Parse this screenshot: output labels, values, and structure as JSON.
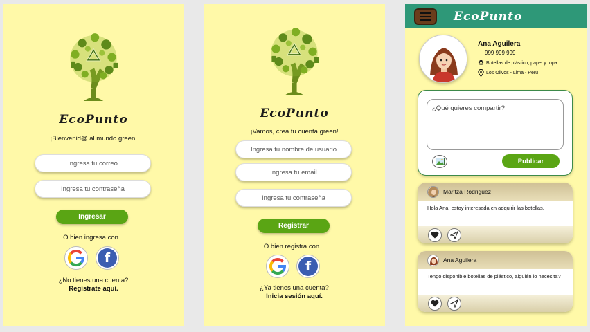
{
  "login": {
    "brand": "EcoPunto",
    "welcome": "¡Bienvenid@ al mundo green!",
    "email_placeholder": "Ingresa tu correo",
    "password_placeholder": "Ingresa tu contraseña",
    "submit_label": "Ingresar",
    "alt_text": "O bien ingresa con...",
    "no_account": "¿No tienes una cuenta?",
    "register_link": "Regístrate aquí."
  },
  "register": {
    "brand": "EcoPunto",
    "welcome": "¡Vamos, crea tu cuenta green!",
    "username_placeholder": "Ingresa tu nombre de usuario",
    "email_placeholder": "Ingresa tu email",
    "password_placeholder": "Ingresa tu contraseña",
    "submit_label": "Registrar",
    "alt_text": "O bien registra con...",
    "have_account": "¿Ya tienes una cuenta?",
    "login_link": "Inicia sesión aquí."
  },
  "profile": {
    "app_title": "EcoPunto",
    "name": "Ana Aguilera",
    "phone": "999 999 999",
    "materials": "Botellas de plástico, papel y ropa",
    "location": "Los Olivos - Lima - Perú",
    "composer_placeholder": "¿Qué quieres compartir?",
    "publish_label": "Publicar",
    "posts": [
      {
        "author": "Maritza Rodriguez",
        "text": "Hola Ana, estoy interesada en adquirir las botellas."
      },
      {
        "author": "Ana Aguilera",
        "text": "Tengo disponible botellas de plástico, alguién lo necesita?"
      }
    ]
  },
  "colors": {
    "background": "#fff9a8",
    "accent_green": "#5aa514",
    "topbar": "#2e9878",
    "facebook": "#3b5db1"
  },
  "icons": [
    "eco-tree-logo",
    "google-icon",
    "facebook-icon",
    "menu-icon",
    "recycle-icon",
    "location-pin-icon",
    "image-icon",
    "heart-icon",
    "send-icon"
  ]
}
